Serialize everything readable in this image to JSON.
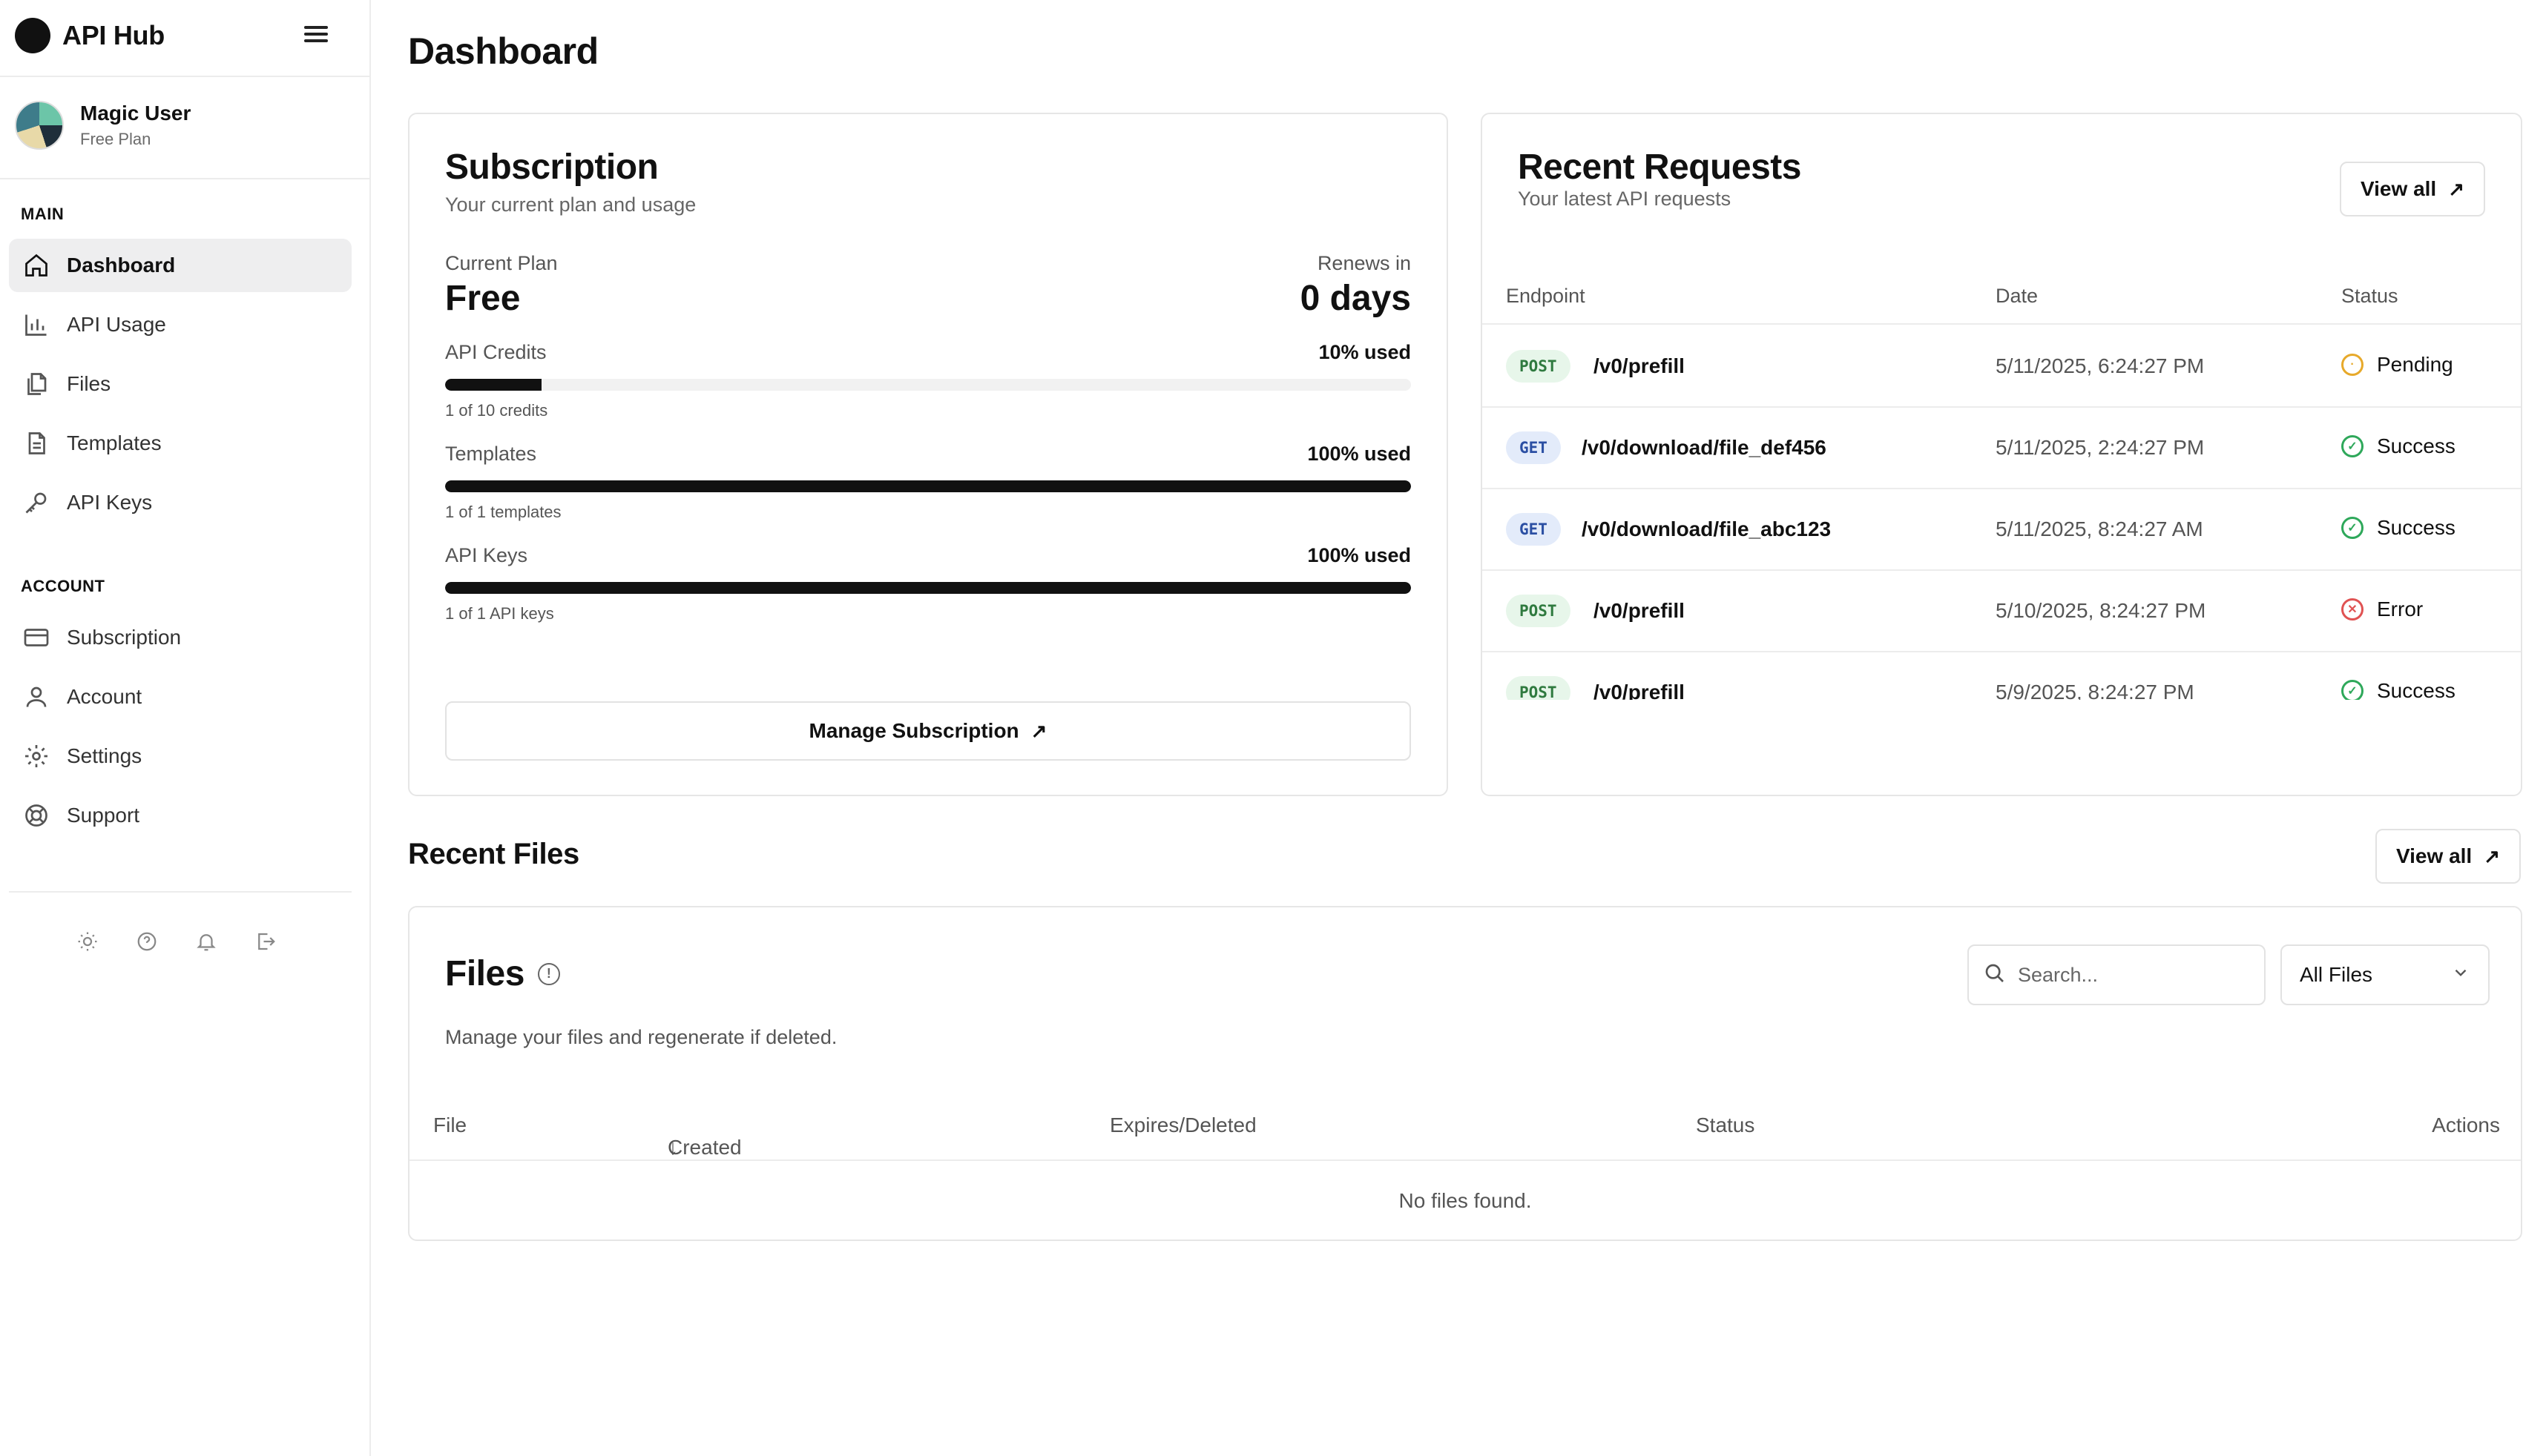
{
  "app": {
    "name": "API Hub"
  },
  "user": {
    "name": "Magic User",
    "plan": "Free Plan"
  },
  "sidebar": {
    "main_label": "MAIN",
    "account_label": "ACCOUNT",
    "main_items": [
      {
        "label": "Dashboard",
        "icon": "home-icon",
        "active": true
      },
      {
        "label": "API Usage",
        "icon": "bar-chart-icon"
      },
      {
        "label": "Files",
        "icon": "files-icon"
      },
      {
        "label": "Templates",
        "icon": "document-icon"
      },
      {
        "label": "API Keys",
        "icon": "key-icon"
      }
    ],
    "account_items": [
      {
        "label": "Subscription",
        "icon": "credit-card-icon"
      },
      {
        "label": "Account",
        "icon": "user-icon"
      },
      {
        "label": "Settings",
        "icon": "gear-icon"
      },
      {
        "label": "Support",
        "icon": "lifebuoy-icon"
      }
    ],
    "footer_icons": [
      "sun-icon",
      "help-icon",
      "bell-icon",
      "logout-icon"
    ]
  },
  "page": {
    "title": "Dashboard"
  },
  "subscription": {
    "title": "Subscription",
    "subtitle": "Your current plan and usage",
    "current_plan_label": "Current Plan",
    "current_plan_value": "Free",
    "renews_label": "Renews in",
    "renews_value": "0 days",
    "meters": [
      {
        "label": "API Credits",
        "used_text": "10% used",
        "fraction": 0.1,
        "foot": "1 of 10 credits"
      },
      {
        "label": "Templates",
        "used_text": "100% used",
        "fraction": 1.0,
        "foot": "1 of 1 templates"
      },
      {
        "label": "API Keys",
        "used_text": "100% used",
        "fraction": 1.0,
        "foot": "1 of 1 API keys"
      }
    ],
    "manage_button": "Manage Subscription"
  },
  "recent_requests": {
    "title": "Recent Requests",
    "subtitle": "Your latest API requests",
    "view_all": "View all",
    "columns": {
      "endpoint": "Endpoint",
      "date": "Date",
      "status": "Status"
    },
    "rows": [
      {
        "method": "POST",
        "endpoint": "/v0/prefill",
        "date": "5/11/2025, 6:24:27 PM",
        "status": "Pending"
      },
      {
        "method": "GET",
        "endpoint": "/v0/download/file_def456",
        "date": "5/11/2025, 2:24:27 PM",
        "status": "Success"
      },
      {
        "method": "GET",
        "endpoint": "/v0/download/file_abc123",
        "date": "5/11/2025, 8:24:27 AM",
        "status": "Success"
      },
      {
        "method": "POST",
        "endpoint": "/v0/prefill",
        "date": "5/10/2025, 8:24:27 PM",
        "status": "Error"
      },
      {
        "method": "POST",
        "endpoint": "/v0/prefill",
        "date": "5/9/2025, 8:24:27 PM",
        "status": "Success"
      }
    ]
  },
  "recent_files": {
    "section_title": "Recent Files",
    "view_all": "View all",
    "card_title": "Files",
    "card_subtitle": "Manage your files and regenerate if deleted.",
    "search_placeholder": "Search...",
    "filter_value": "All Files",
    "columns": {
      "file": "File",
      "created": "Created",
      "expires": "Expires/Deleted",
      "status": "Status",
      "actions": "Actions"
    },
    "empty_message": "No files found."
  }
}
